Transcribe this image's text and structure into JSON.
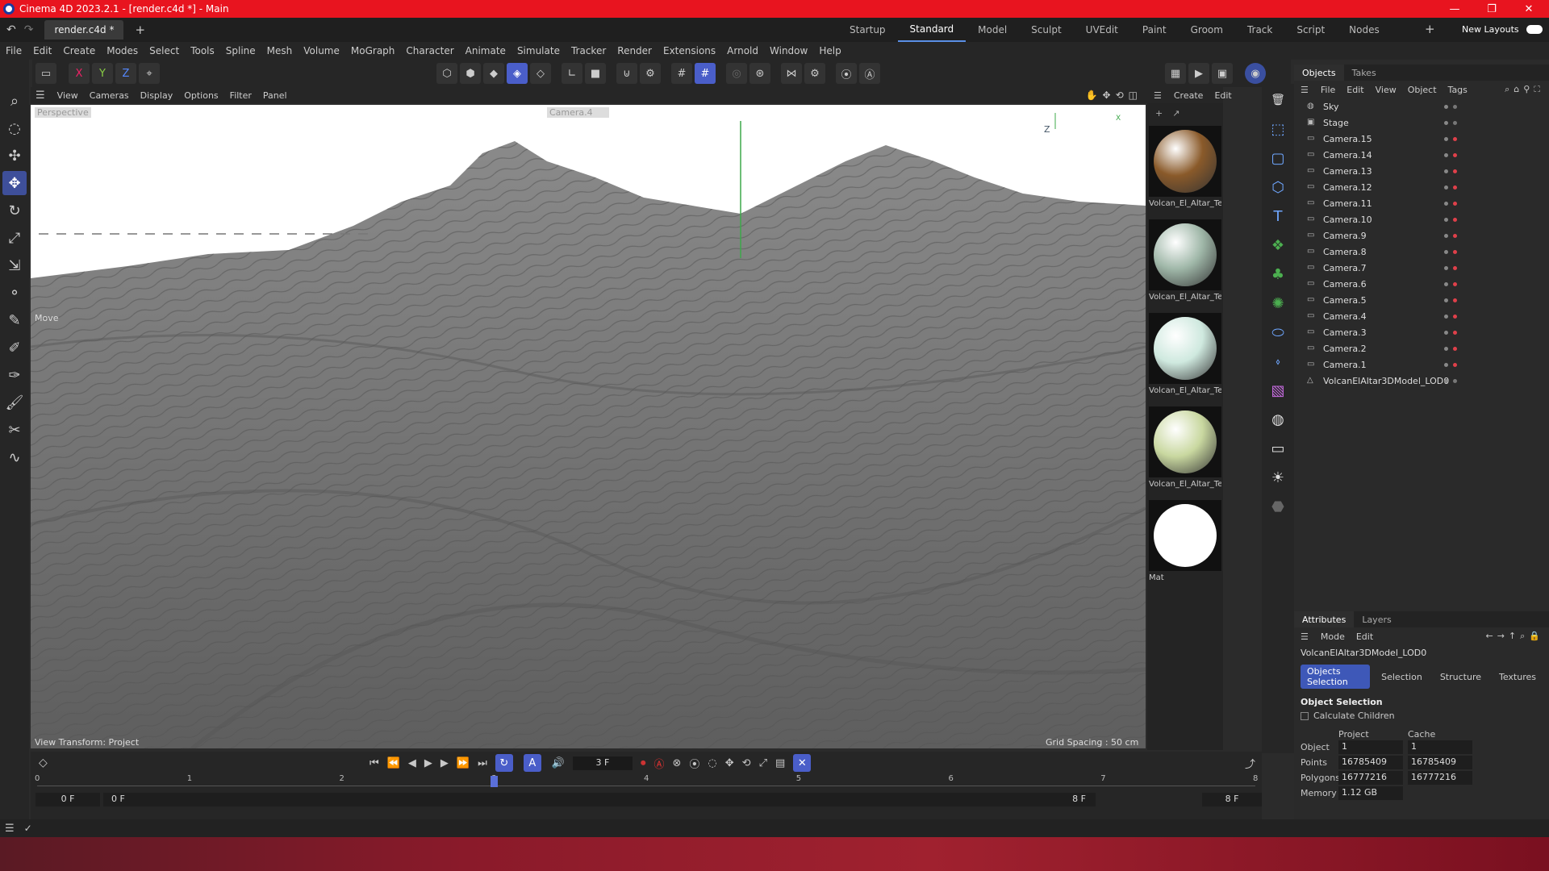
{
  "window": {
    "title": "Cinema 4D 2023.2.1 - [render.c4d *] - Main",
    "minimize": "—",
    "maximize": "❐",
    "close": "✕"
  },
  "tabs": {
    "document": "render.c4d *",
    "add": "+",
    "layouts": [
      "Startup",
      "Standard",
      "Model",
      "Sculpt",
      "UVEdit",
      "Paint",
      "Groom",
      "Track",
      "Script",
      "Nodes"
    ],
    "active_layout": "Standard",
    "new_layouts": "New Layouts"
  },
  "menus": [
    "File",
    "Edit",
    "Create",
    "Modes",
    "Select",
    "Tools",
    "Spline",
    "Mesh",
    "Volume",
    "MoGraph",
    "Character",
    "Animate",
    "Simulate",
    "Tracker",
    "Render",
    "Extensions",
    "Arnold",
    "Window",
    "Help"
  ],
  "toolbar": {
    "axis_x": "X",
    "axis_y": "Y",
    "axis_z": "Z"
  },
  "viewport": {
    "menu": [
      "View",
      "Cameras",
      "Display",
      "Options",
      "Filter",
      "Panel"
    ],
    "camera_label": "Perspective",
    "camera_name": "Camera.4",
    "tool_label": "Move",
    "view_transform": "View Transform: Project",
    "grid_spacing": "Grid Spacing : 50 cm",
    "axis_z": "Z",
    "axis_x": "X"
  },
  "materials": {
    "menu": [
      "Create",
      "Edit"
    ],
    "items": [
      {
        "name": "Volcan_El_Altar_Te",
        "color": "#8a5a2a"
      },
      {
        "name": "Volcan_El_Altar_Te",
        "color": "#9fb7a8"
      },
      {
        "name": "Volcan_El_Altar_Te",
        "color": "#cfe9df"
      },
      {
        "name": "Volcan_El_Altar_Te",
        "color": "#c9d8a0"
      },
      {
        "name": "Mat",
        "color": "#ffffff"
      }
    ]
  },
  "objects": {
    "tabs": [
      "Objects",
      "Takes"
    ],
    "menu": [
      "File",
      "Edit",
      "View",
      "Object",
      "Tags"
    ],
    "items": [
      "Sky",
      "Stage",
      "Camera.15",
      "Camera.14",
      "Camera.13",
      "Camera.12",
      "Camera.11",
      "Camera.10",
      "Camera.9",
      "Camera.8",
      "Camera.7",
      "Camera.6",
      "Camera.5",
      "Camera.4",
      "Camera.3",
      "Camera.2",
      "Camera.1",
      "VolcanElAltar3DModel_LOD0"
    ]
  },
  "attributes": {
    "tabs": [
      "Attributes",
      "Layers"
    ],
    "menu": [
      "Mode",
      "Edit"
    ],
    "object_name": "VolcanElAltar3DModel_LOD0",
    "subtabs": [
      "Objects Selection",
      "Selection",
      "Structure",
      "Textures"
    ],
    "section": "Object Selection",
    "calc_children": "Calculate Children",
    "col_project": "Project",
    "col_cache": "Cache",
    "rows": [
      {
        "label": "Object",
        "project": "1",
        "cache": "1"
      },
      {
        "label": "Points",
        "project": "16785409",
        "cache": "16785409"
      },
      {
        "label": "Polygons",
        "project": "16777216",
        "cache": "16777216"
      },
      {
        "label": "Memory",
        "project": "1.12 GB",
        "cache": ""
      }
    ]
  },
  "timeline": {
    "current_frame": "3 F",
    "ruler": [
      "0",
      "1",
      "2",
      "3",
      "4",
      "5",
      "6",
      "7",
      "8"
    ],
    "playhead_frame": 3,
    "total_frames": 8,
    "start": "0 F",
    "start2": "0 F",
    "end": "8 F",
    "end2": "8 F"
  },
  "colors": {
    "accent": "#4a5ec9",
    "title_bar": "#e8141f"
  }
}
